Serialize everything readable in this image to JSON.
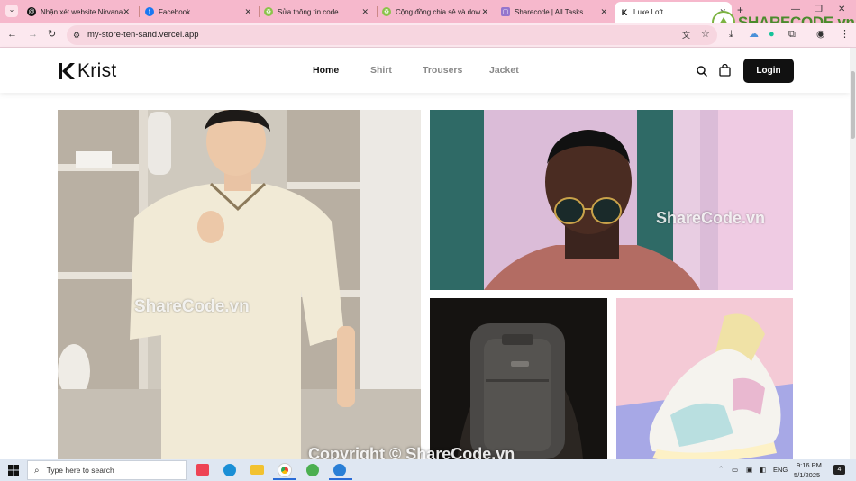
{
  "browser": {
    "tabs": [
      {
        "title": "Nhận xét website Nirvana",
        "icon": "threads-icon"
      },
      {
        "title": "Facebook",
        "icon": "facebook-icon"
      },
      {
        "title": "Sửa thông tin code",
        "icon": "sharecode-icon"
      },
      {
        "title": "Cộng đồng chia sẻ và dow",
        "icon": "sharecode-icon"
      },
      {
        "title": "Sharecode | All Tasks",
        "icon": "tasks-icon"
      },
      {
        "title": "Luxe Loft",
        "icon": "krist-icon"
      }
    ],
    "new_tab": "+",
    "url": "my-store-ten-sand.vercel.app"
  },
  "site": {
    "brand": "Krist",
    "nav": [
      "Home",
      "Shirt",
      "Trousers",
      "Jacket"
    ],
    "login": "Login"
  },
  "watermarks": {
    "logo": "SHARECODE.vn",
    "mid_left": "ShareCode.vn",
    "mid_right": "ShareCode.vn",
    "bottom": "Copyright © ShareCode.vn"
  },
  "taskbar": {
    "search_placeholder": "Type here to search",
    "language": "ENG",
    "time": "9:16 PM",
    "date": "5/1/2025",
    "notification_count": "4"
  },
  "colors": {
    "tab_strip": "#f6b8cc",
    "login_bg": "#111111",
    "accent": "#7cb342"
  }
}
